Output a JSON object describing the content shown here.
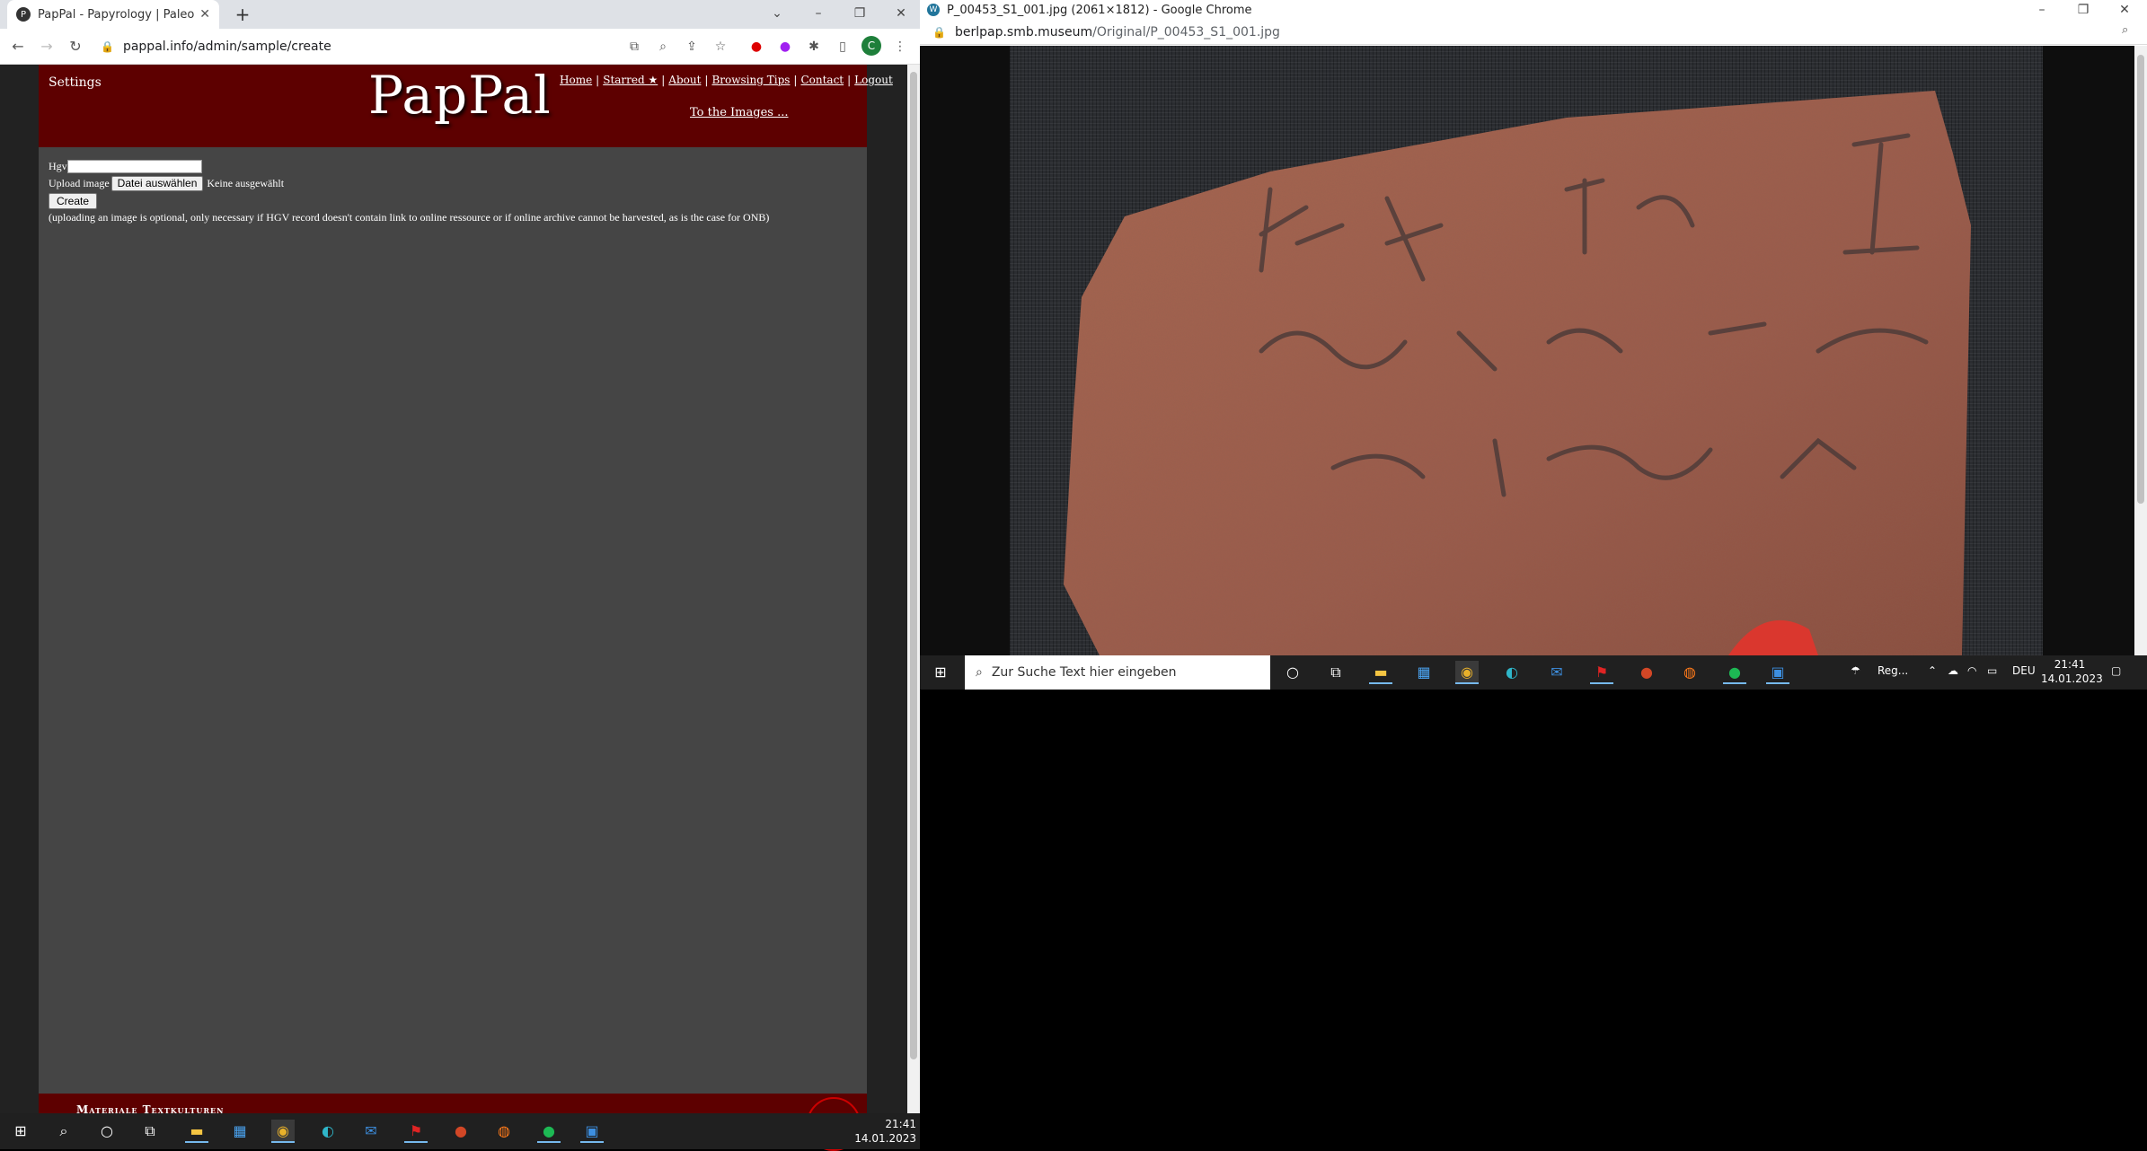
{
  "left_browser": {
    "tab_title": "PapPal - Papyrology | Paleograph",
    "url": "pappal.info/admin/sample/create",
    "profile_letter": "C"
  },
  "page": {
    "settings_label": "Settings",
    "logo": "PapPal",
    "nav": [
      "Home",
      "Starred ★",
      "About",
      "Browsing Tips",
      "Contact",
      "Logout"
    ],
    "images_link": "To the Images ...",
    "form": {
      "hgv_label": "Hgv",
      "upload_label": "Upload image",
      "file_button": "Datei auswählen",
      "file_status": "Keine ausgewählt",
      "create_button": "Create",
      "note": "(uploading an image is optional, only necessary if HGV record doesn't contain link to online ressource or if online archive cannot be harvested, as is the case for ONB)"
    },
    "footer_text": "Materiale Textkulturen"
  },
  "right_window": {
    "title": "P_00453_S1_001.jpg (2061×1812) - Google Chrome",
    "url_host": "berlpap.smb.museum",
    "url_path": "/Original/P_00453_S1_001.jpg"
  },
  "right_taskbar": {
    "search_placeholder": "Zur Suche Text hier eingeben",
    "weather": "Reg...",
    "lang": "DEU",
    "time": "21:41",
    "date": "14.01.2023"
  },
  "bottom_taskbar": {
    "time": "21:41",
    "date": "14.01.2023"
  },
  "colors": {
    "header_maroon": "#5d0000",
    "content_gray": "#454545",
    "ostracon": "#9b5a4a"
  }
}
